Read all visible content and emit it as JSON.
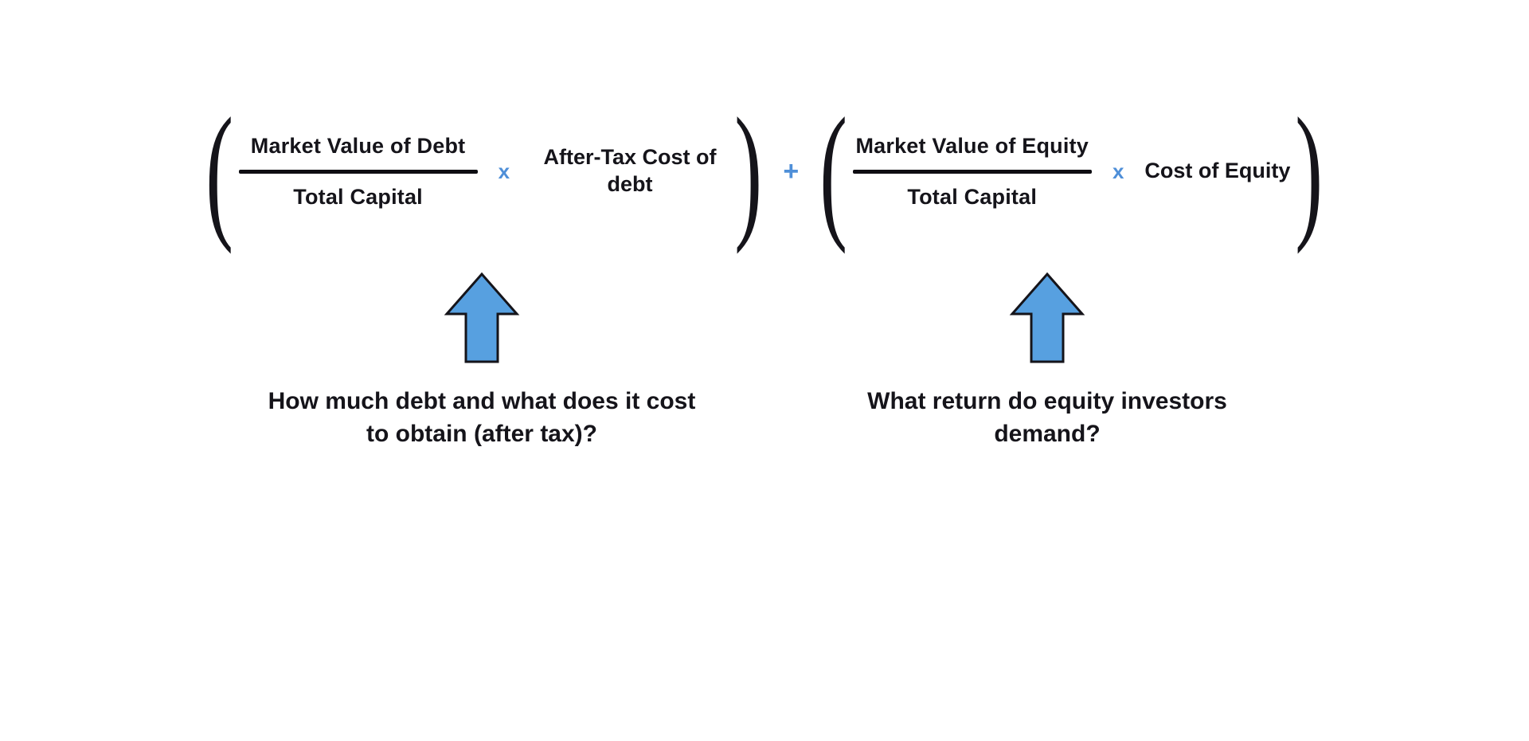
{
  "formula": {
    "debt_term": {
      "open_paren": "(",
      "fraction": {
        "numerator": "Market Value of Debt",
        "denominator": "Total Capital"
      },
      "times": "x",
      "multiplier": "After-Tax Cost of debt",
      "close_paren": ")"
    },
    "plus": "+",
    "equity_term": {
      "open_paren": "(",
      "fraction": {
        "numerator": "Market Value of Equity",
        "denominator": "Total Capital"
      },
      "times": "x",
      "multiplier": "Cost of Equity",
      "close_paren": ")"
    }
  },
  "annotations": {
    "debt_caption": "How much debt and what does it cost to obtain (after tax)?",
    "equity_caption": "What return do equity investors demand?"
  },
  "colors": {
    "accent": "#57a0e0",
    "text": "#15141a"
  }
}
